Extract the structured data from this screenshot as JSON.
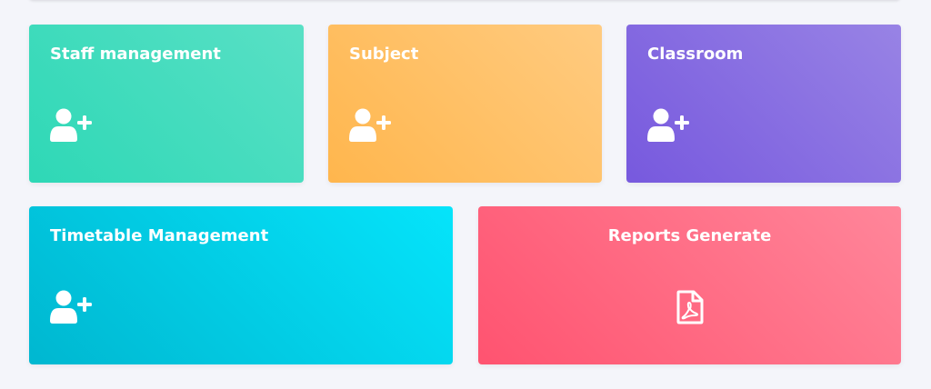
{
  "cards": [
    {
      "id": "staff",
      "title": "Staff management",
      "icon": "user-plus-icon",
      "color_from": "#2ed8b6",
      "color_to": "#59e0c5"
    },
    {
      "id": "subject",
      "title": "Subject",
      "icon": "user-plus-icon",
      "color_from": "#ffb64d",
      "color_to": "#ffcb80"
    },
    {
      "id": "classroom",
      "title": "Classroom",
      "icon": "user-plus-icon",
      "color_from": "#7759de",
      "color_to": "#9883e5"
    },
    {
      "id": "timetable",
      "title": "Timetable Management",
      "icon": "user-plus-icon",
      "color_from": "#00b7d0",
      "color_to": "#05e4fb"
    },
    {
      "id": "reports",
      "title": "Reports Generate",
      "icon": "file-pdf-icon",
      "color_from": "#ff5370",
      "color_to": "#ff869a"
    }
  ]
}
